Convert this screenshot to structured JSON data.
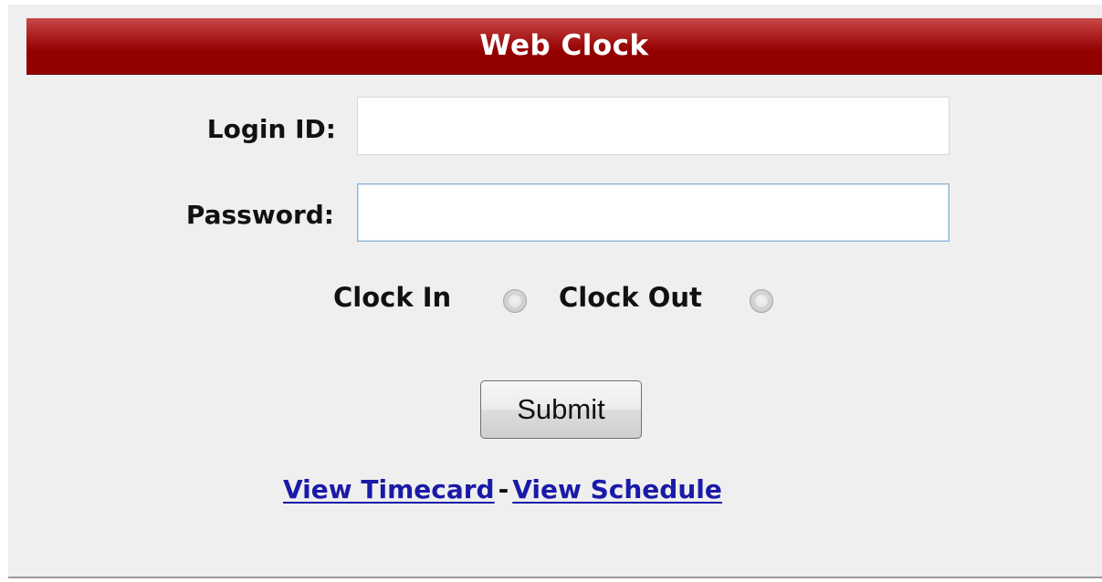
{
  "header": {
    "title": "Web Clock"
  },
  "form": {
    "login_label": "Login ID:",
    "login_value": "",
    "password_label": "Password:",
    "password_value": "",
    "clock_in_label": "Clock In",
    "clock_in_selected": false,
    "clock_out_label": "Clock Out",
    "clock_out_selected": false,
    "submit_label": "Submit"
  },
  "links": {
    "view_timecard": "View Timecard",
    "separator": "-",
    "view_schedule": "View Schedule"
  },
  "colors": {
    "header_bg": "#930000",
    "header_text": "#ffffff",
    "panel_bg": "#efefef",
    "link": "#1a1aa8"
  }
}
